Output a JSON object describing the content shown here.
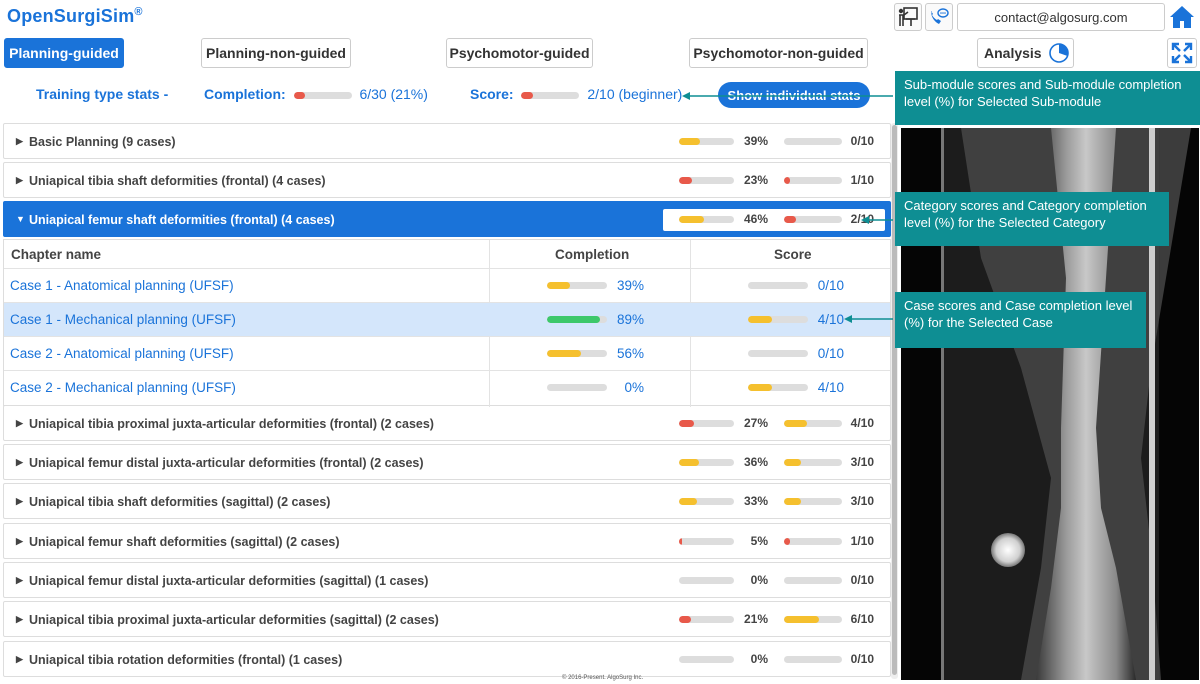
{
  "app": {
    "title": "OpenSurgiSim",
    "trademark": "®"
  },
  "header": {
    "contact": "contact@algosurg.com",
    "icons": [
      "presentation-icon",
      "phone-chat-icon",
      "home-icon"
    ]
  },
  "tabs": [
    {
      "label": "Planning-guided",
      "active": true
    },
    {
      "label": "Planning-non-guided",
      "active": false
    },
    {
      "label": "Psychomotor-guided",
      "active": false
    },
    {
      "label": "Psychomotor-non-guided",
      "active": false
    },
    {
      "label": "Analysis",
      "active": false
    }
  ],
  "stats": {
    "training_label": "Training type stats -",
    "completion_label": "Completion:",
    "completion_value": "6/30 (21%)",
    "completion_fraction": 0.2,
    "score_label": "Score:",
    "score_value": "2/10 (beginner)",
    "score_fraction": 0.2,
    "show_button": "Show individual stats"
  },
  "colors": {
    "accent": "#1a73d9",
    "red": "#e8594a",
    "yellow": "#f5c02e",
    "green": "#3dc86a",
    "teal": "#0e8e93"
  },
  "categories": [
    {
      "title": "Basic Planning   (9 cases)",
      "completion": "39%",
      "completion_fraction": 0.39,
      "completion_color": "#f5c02e",
      "score": "0/10",
      "score_fraction": 0,
      "score_color": "#ddd"
    },
    {
      "title": "Uniapical tibia shaft deformities (frontal)   (4 cases)",
      "completion": "23%",
      "completion_fraction": 0.23,
      "completion_color": "#e8594a",
      "score": "1/10",
      "score_fraction": 0.1,
      "score_color": "#e8594a"
    },
    {
      "title": "Uniapical femur shaft deformities (frontal)   (4 cases)",
      "completion": "46%",
      "completion_fraction": 0.46,
      "completion_color": "#f5c02e",
      "score": "2/10",
      "score_fraction": 0.2,
      "score_color": "#e8594a",
      "expanded": true
    },
    {
      "title": "Uniapical tibia proximal juxta-articular deformities (frontal)   (2 cases)",
      "completion": "27%",
      "completion_fraction": 0.27,
      "completion_color": "#e8594a",
      "score": "4/10",
      "score_fraction": 0.4,
      "score_color": "#f5c02e"
    },
    {
      "title": "Uniapical femur distal juxta-articular deformities (frontal)   (2 cases)",
      "completion": "36%",
      "completion_fraction": 0.36,
      "completion_color": "#f5c02e",
      "score": "3/10",
      "score_fraction": 0.3,
      "score_color": "#f5c02e"
    },
    {
      "title": "Uniapical tibia shaft deformities (sagittal)   (2 cases)",
      "completion": "33%",
      "completion_fraction": 0.33,
      "completion_color": "#f5c02e",
      "score": "3/10",
      "score_fraction": 0.3,
      "score_color": "#f5c02e"
    },
    {
      "title": "Uniapical femur shaft deformities (sagittal)   (2 cases)",
      "completion": "5%",
      "completion_fraction": 0.05,
      "completion_color": "#e8594a",
      "score": "1/10",
      "score_fraction": 0.1,
      "score_color": "#e8594a"
    },
    {
      "title": "Uniapical femur distal juxta-articular deformities (sagittal)   (1 cases)",
      "completion": "0%",
      "completion_fraction": 0,
      "completion_color": "#ddd",
      "score": "0/10",
      "score_fraction": 0,
      "score_color": "#ddd"
    },
    {
      "title": "Uniapical tibia proximal juxta-articular deformities (sagittal)   (2 cases)",
      "completion": "21%",
      "completion_fraction": 0.21,
      "completion_color": "#e8594a",
      "score": "6/10",
      "score_fraction": 0.6,
      "score_color": "#f5c02e"
    },
    {
      "title": "Uniapical tibia rotation deformities (frontal)   (1 cases)",
      "completion": "0%",
      "completion_fraction": 0,
      "completion_color": "#ddd",
      "score": "0/10",
      "score_fraction": 0,
      "score_color": "#ddd"
    }
  ],
  "detail": {
    "headers": {
      "chapter": "Chapter name",
      "completion": "Completion",
      "score": "Score"
    },
    "rows": [
      {
        "name": "Case 1 - Anatomical planning (UFSF)",
        "completion": "39%",
        "completion_fraction": 0.39,
        "completion_color": "#f5c02e",
        "score": "0/10",
        "score_fraction": 0,
        "score_color": "#ddd",
        "selected": false
      },
      {
        "name": "Case 1 - Mechanical planning (UFSF)",
        "completion": "89%",
        "completion_fraction": 0.89,
        "completion_color": "#3dc86a",
        "score": "4/10",
        "score_fraction": 0.4,
        "score_color": "#f5c02e",
        "selected": true
      },
      {
        "name": "Case 2 - Anatomical planning (UFSF)",
        "completion": "56%",
        "completion_fraction": 0.56,
        "completion_color": "#f5c02e",
        "score": "0/10",
        "score_fraction": 0,
        "score_color": "#ddd",
        "selected": false
      },
      {
        "name": "Case 2 - Mechanical planning (UFSF)",
        "completion": "0%",
        "completion_fraction": 0,
        "completion_color": "#ddd",
        "score": "4/10",
        "score_fraction": 0.4,
        "score_color": "#f5c02e",
        "selected": false
      }
    ]
  },
  "callouts": [
    "Sub-module scores and Sub-module completion level (%) for Selected Sub-module",
    "Category scores and Category completion level (%) for the Selected Category",
    "Case scores and Case completion level (%) for the Selected Case"
  ],
  "footer": "© 2016-Present. AlgoSurg Inc."
}
